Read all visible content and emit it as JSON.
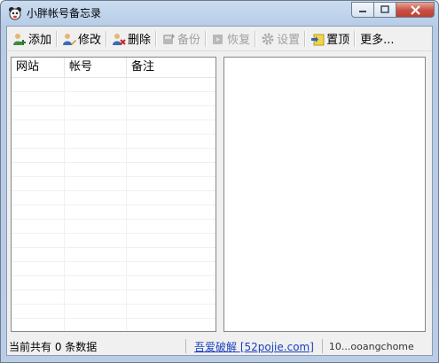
{
  "window": {
    "title": "小胖帐号备忘录"
  },
  "toolbar": {
    "items": [
      {
        "label": "添加",
        "icon": "add-user-icon",
        "enabled": true
      },
      {
        "label": "修改",
        "icon": "edit-user-icon",
        "enabled": true
      },
      {
        "label": "删除",
        "icon": "delete-user-icon",
        "enabled": true
      },
      {
        "label": "备份",
        "icon": "backup-icon",
        "enabled": false
      },
      {
        "label": "恢复",
        "icon": "restore-icon",
        "enabled": false
      },
      {
        "label": "设置",
        "icon": "settings-gear-icon",
        "enabled": false
      },
      {
        "label": "置顶",
        "icon": "pin-top-icon",
        "enabled": true
      },
      {
        "label": "更多...",
        "icon": "",
        "enabled": true
      }
    ]
  },
  "table": {
    "columns": [
      "网站",
      "帐号",
      "备注"
    ],
    "rows": []
  },
  "status": {
    "count_text": "当前共有 0 条数据",
    "link_text": "吾爱破解 [52pojie.com]",
    "url_text": "10...ooangchome"
  }
}
